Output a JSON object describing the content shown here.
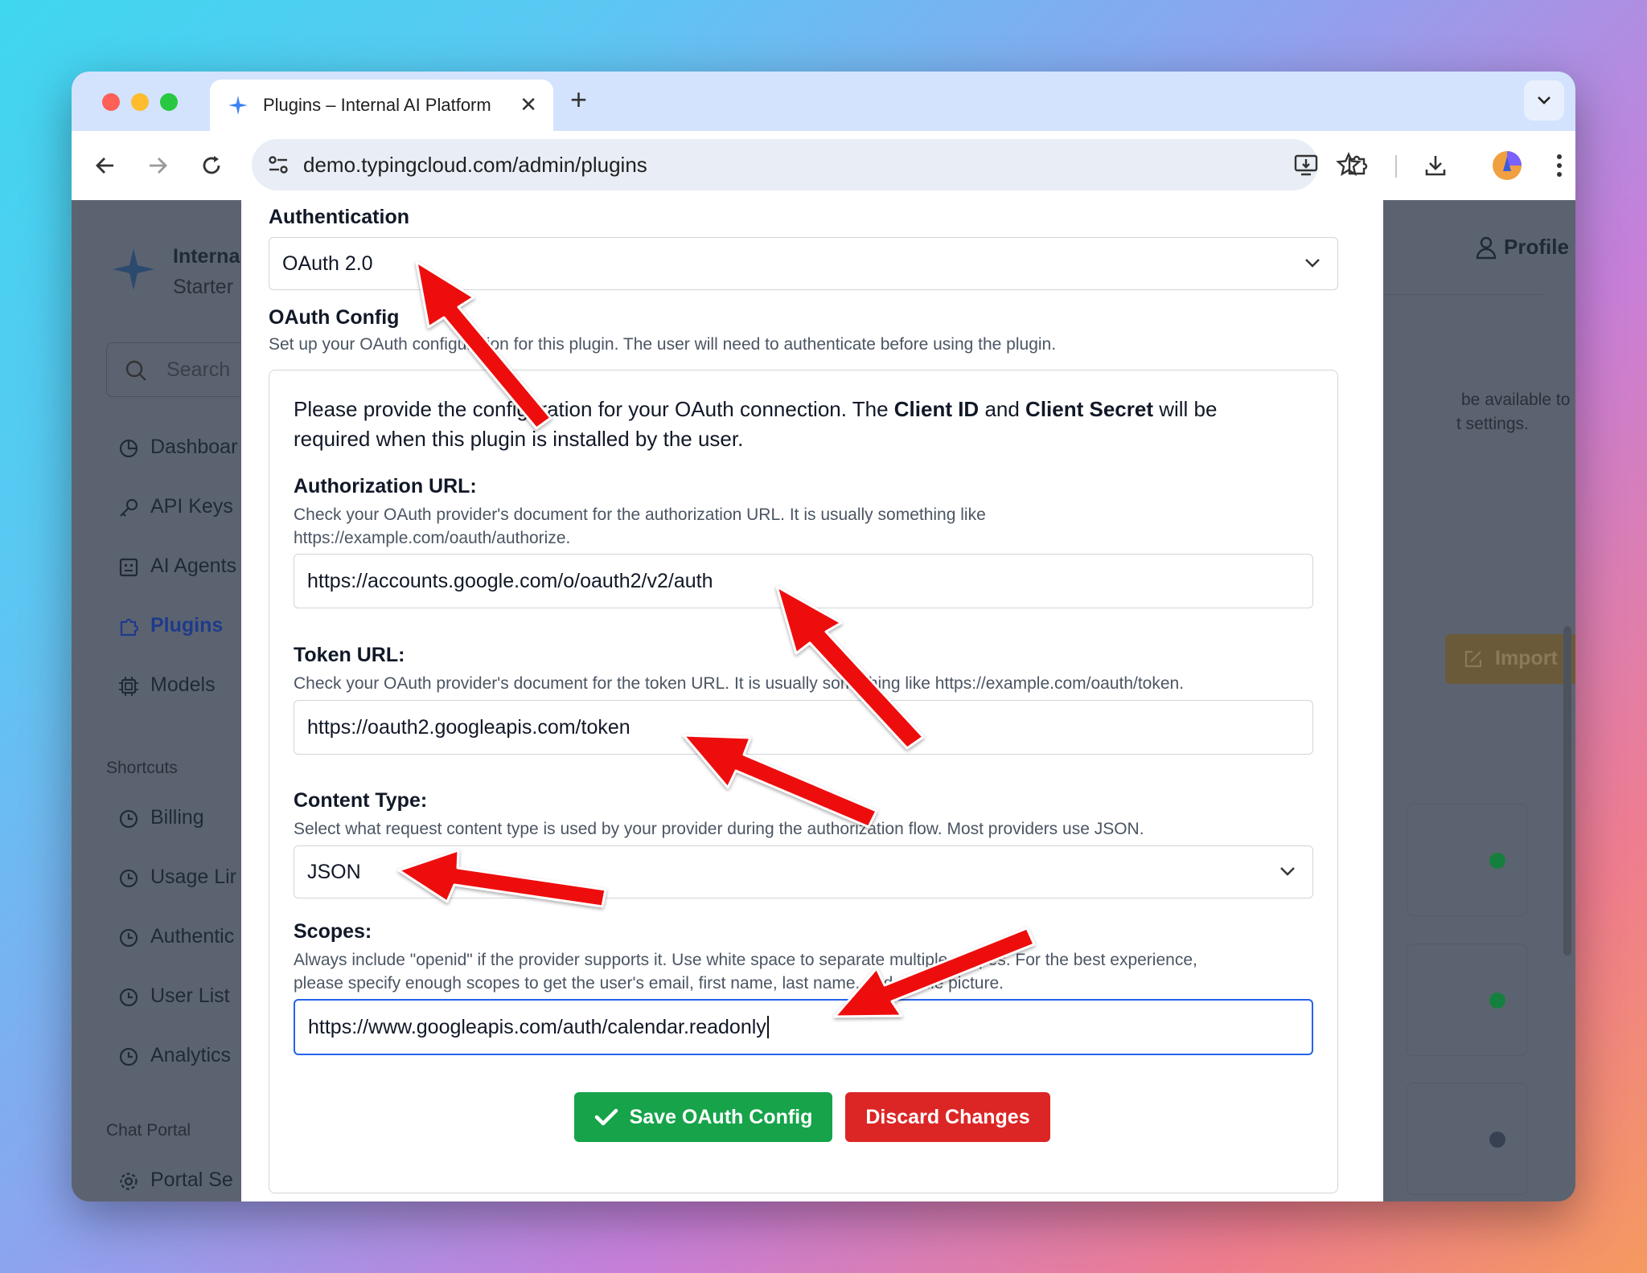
{
  "browser": {
    "tab_title": "Plugins – Internal AI Platform",
    "url": "demo.typingcloud.com/admin/plugins"
  },
  "sidebar": {
    "brand_line1": "Interna",
    "brand_line2": "Starter",
    "search_placeholder": "Search",
    "items": [
      {
        "label": "Dashboar",
        "icon": "chart-pie-icon"
      },
      {
        "label": "API Keys",
        "icon": "key-icon"
      },
      {
        "label": "AI Agents",
        "icon": "robot-icon"
      },
      {
        "label": "Plugins",
        "icon": "puzzle-icon"
      },
      {
        "label": "Models",
        "icon": "cpu-icon"
      }
    ],
    "shortcuts_heading": "Shortcuts",
    "shortcuts": [
      "Billing",
      "Usage Lir",
      "Authentic",
      "User List",
      "Analytics"
    ],
    "chat_portal_heading": "Chat Portal",
    "portal_item": "Portal Se"
  },
  "background_page": {
    "profile_label": "Profile",
    "note_line1": "be available to",
    "note_line2": "t settings.",
    "import_label": "Import",
    "status_colors": [
      "#15803d",
      "#15803d",
      "#374151"
    ]
  },
  "modal": {
    "auth_label": "Authentication",
    "auth_value": "OAuth 2.0",
    "oauth_title": "OAuth Config",
    "oauth_desc": "Set up your OAuth configuration for this plugin. The user will need to authenticate before using the plugin.",
    "intro_part1": "Please provide the configuration for your OAuth connection. The ",
    "intro_bold1": "Client ID",
    "intro_part2": " and ",
    "intro_bold2": "Client Secret",
    "intro_part3": " will be required when this plugin is installed by the user.",
    "auth_url_label": "Authorization URL:",
    "auth_url_help": "Check your OAuth provider's document for the authorization URL. It is usually something like https://example.com/oauth/authorize.",
    "auth_url_value": "https://accounts.google.com/o/oauth2/v2/auth",
    "token_url_label": "Token URL:",
    "token_url_help": "Check your OAuth provider's document for the token URL. It is usually something like https://example.com/oauth/token.",
    "token_url_value": "https://oauth2.googleapis.com/token",
    "content_type_label": "Content Type:",
    "content_type_help": "Select what request content type is used by your provider during the authorization flow. Most providers use JSON.",
    "content_type_value": "JSON",
    "scopes_label": "Scopes:",
    "scopes_help": "Always include \"openid\" if the provider supports it. Use white space to separate multiple scopes. For the best experience, please specify enough scopes to get the user's email, first name, last name, and profile picture.",
    "scopes_value": "https://www.googleapis.com/auth/calendar.readonly",
    "save_label": "Save OAuth Config",
    "discard_label": "Discard Changes"
  },
  "colors": {
    "save": "#16a34a",
    "discard": "#dc2626",
    "accent": "#2563eb",
    "annotation_arrow": "#ee1111"
  }
}
